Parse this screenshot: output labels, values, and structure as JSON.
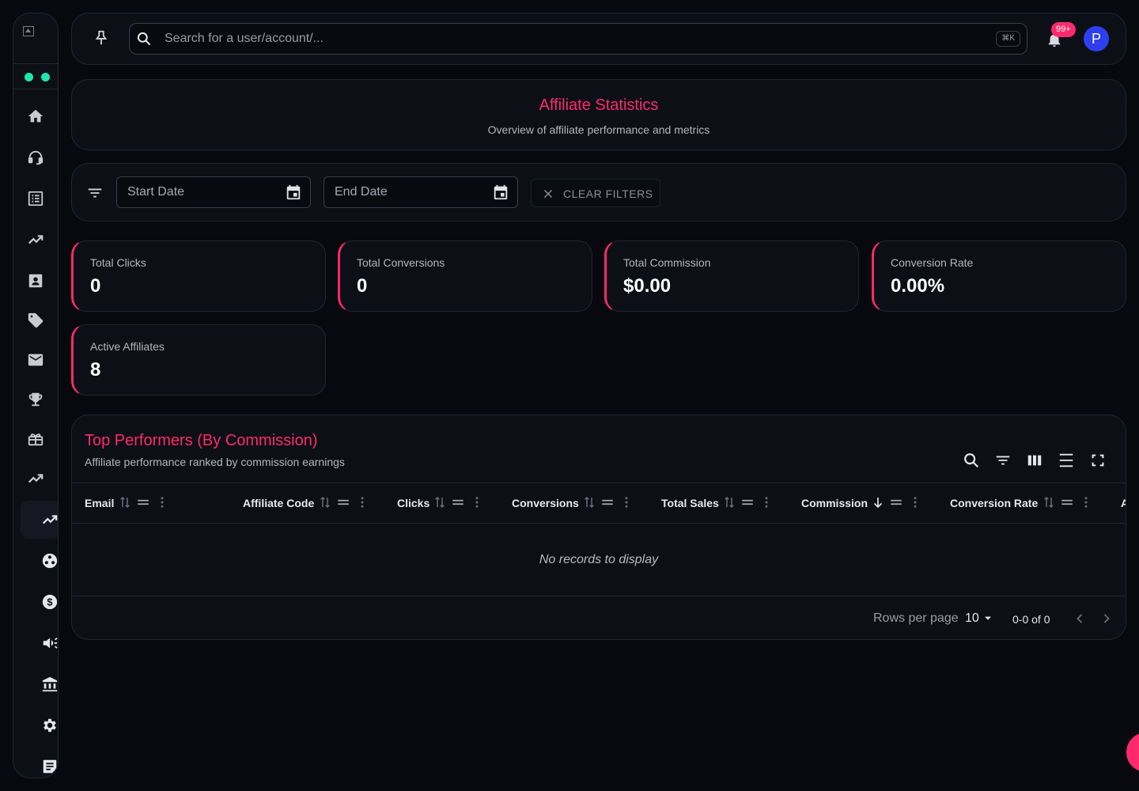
{
  "sidebar": {
    "items": [
      {
        "name": "home-icon"
      },
      {
        "name": "support-agent-icon"
      },
      {
        "name": "list-icon"
      },
      {
        "name": "trending-up-icon"
      },
      {
        "name": "contact-card-icon"
      },
      {
        "name": "tag-icon"
      },
      {
        "name": "mail-icon"
      },
      {
        "name": "trophy-icon"
      },
      {
        "name": "gift-icon"
      },
      {
        "name": "trending-up-icon"
      }
    ],
    "sub_items": [
      {
        "name": "trending-up-icon",
        "active": true
      },
      {
        "name": "network-icon"
      },
      {
        "name": "dollar-icon"
      },
      {
        "name": "campaign-icon"
      },
      {
        "name": "bank-icon"
      },
      {
        "name": "gear-icon"
      },
      {
        "name": "notes-icon"
      }
    ],
    "status_dot_color": "#1ee6b0"
  },
  "topbar": {
    "search_placeholder": "Search for a user/account/...",
    "search_shortcut": "⌘K",
    "notification_badge": "99+",
    "avatar_initial": "P",
    "avatar_color": "#2d3ff0"
  },
  "header": {
    "title": "Affiliate Statistics",
    "subtitle": "Overview of affiliate performance and metrics"
  },
  "filters": {
    "start_date_label": "Start Date",
    "end_date_label": "End Date",
    "clear_label": "CLEAR FILTERS"
  },
  "stats": [
    {
      "title": "Total Clicks",
      "value": "0"
    },
    {
      "title": "Total Conversions",
      "value": "0"
    },
    {
      "title": "Total Commission",
      "value": "$0.00"
    },
    {
      "title": "Conversion Rate",
      "value": "0.00%"
    },
    {
      "title": "Active Affiliates",
      "value": "8"
    }
  ],
  "table": {
    "title": "Top Performers (By Commission)",
    "subtitle": "Affiliate performance ranked by commission earnings",
    "columns": [
      "Email",
      "Affiliate Code",
      "Clicks",
      "Conversions",
      "Total Sales",
      "Commission",
      "Conversion Rate",
      "A"
    ],
    "sorted_column": "Commission",
    "empty_text": "No records to display",
    "pagination": {
      "rows_per_page_label": "Rows per page",
      "rows_per_page": "10",
      "range": "0-0 of 0"
    }
  },
  "accent_color": "#ff2a6d"
}
